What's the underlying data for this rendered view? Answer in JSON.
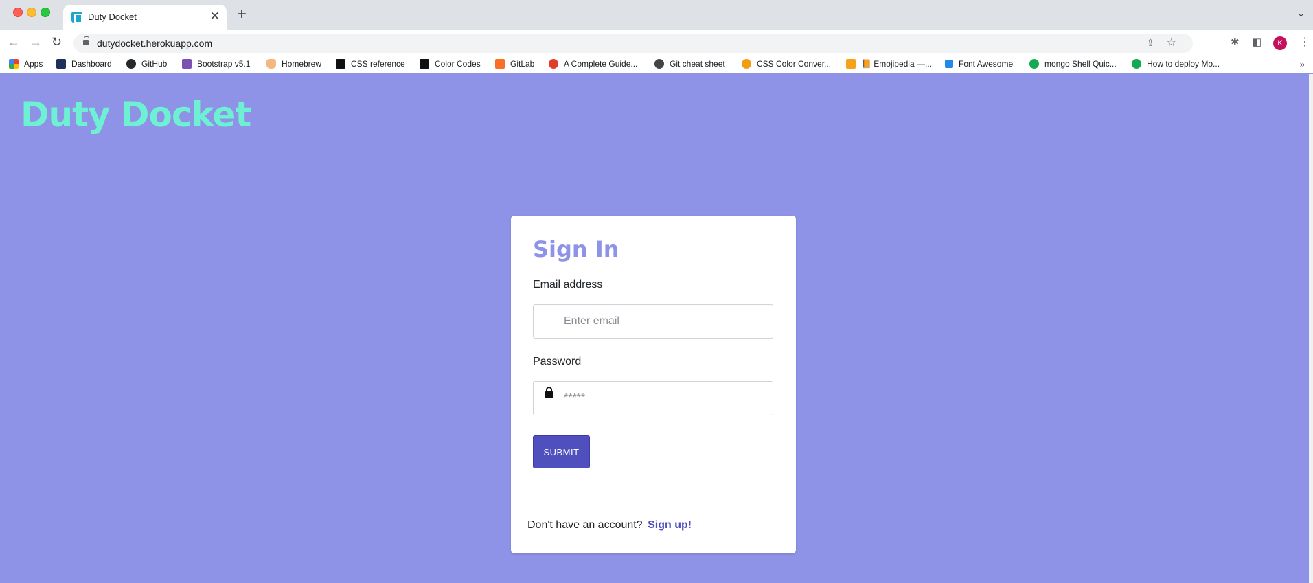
{
  "browser": {
    "tab": {
      "title": "Duty Docket",
      "close_glyph": "✕"
    },
    "new_tab_glyph": "+",
    "tab_search_glyph": "⌄",
    "nav": {
      "back": "←",
      "forward": "→",
      "reload": "↻"
    },
    "url": "dutydocket.herokuapp.com",
    "icons": {
      "share": "⇪",
      "star": "☆",
      "extensions": "✱",
      "sidebar": "◧",
      "menu": "⋮"
    },
    "profile_initial": "K",
    "bookmarks_more": "»",
    "bookmarks": [
      {
        "label": "Apps",
        "icon": "apps-grid-icon",
        "color": "#e94235"
      },
      {
        "label": "Dashboard",
        "icon": "dashboard-icon",
        "color": "#1f2f5c"
      },
      {
        "label": "GitHub",
        "icon": "github-icon",
        "color": "#24292e"
      },
      {
        "label": "Bootstrap v5.1",
        "icon": "bootstrap-icon",
        "color": "#7952b3"
      },
      {
        "label": "Homebrew",
        "icon": "homebrew-icon",
        "color": "#f4b780"
      },
      {
        "label": "CSS reference",
        "icon": "css-reference-icon",
        "color": "#111111"
      },
      {
        "label": "Color Codes",
        "icon": "color-codes-icon",
        "color": "#111111"
      },
      {
        "label": "GitLab",
        "icon": "gitlab-icon",
        "color": "#fc6d26"
      },
      {
        "label": "A Complete Guide...",
        "icon": "css-tricks-icon",
        "color": "#e03e2d"
      },
      {
        "label": "Git cheat sheet",
        "icon": "git-cheat-sheet-icon",
        "color": "#444444"
      },
      {
        "label": "CSS Color Conver...",
        "icon": "css-color-converter-icon",
        "color": "#f29c11"
      },
      {
        "label": "📙 Emojipedia —...",
        "icon": "emojipedia-icon",
        "color": "#f7a21b"
      },
      {
        "label": "Font Awesome",
        "icon": "font-awesome-flag-icon",
        "color": "#228ae6"
      },
      {
        "label": "mongo Shell Quic...",
        "icon": "mongodb-icon",
        "color": "#13aa52"
      },
      {
        "label": "How to deploy Mo...",
        "icon": "mongodb-icon",
        "color": "#13aa52"
      }
    ]
  },
  "page": {
    "brand": "Duty Docket",
    "background_color": "#8e93e8",
    "accent_color": "#4f4fbd",
    "brand_color": "#6ef0d3",
    "form": {
      "title": "Sign In",
      "email": {
        "label": "Email address",
        "placeholder": "Enter email",
        "value": "",
        "icon": "envelope-icon"
      },
      "password": {
        "label": "Password",
        "placeholder": "*****",
        "value": "",
        "icon": "lock-icon"
      },
      "submit_label": "SUBMIT",
      "signup_prompt": "Don't have an account?",
      "signup_link": "Sign up!"
    }
  }
}
